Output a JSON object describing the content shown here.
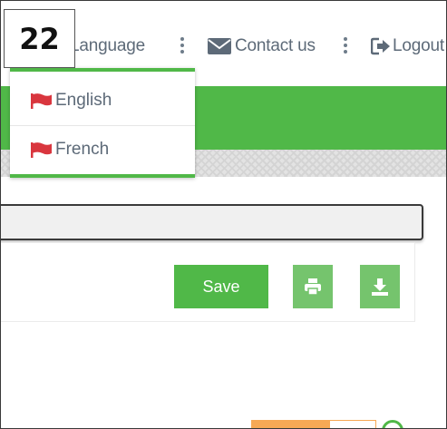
{
  "step": {
    "number": "22"
  },
  "topnav": {
    "language_label": "Language",
    "contact_label": "Contact us",
    "logout_label": "Logout"
  },
  "language_menu": {
    "items": [
      {
        "label": "English",
        "icon": "flag-icon"
      },
      {
        "label": "French",
        "icon": "flag-icon"
      }
    ]
  },
  "toolbar": {
    "save_label": "Save",
    "print_icon": "printer-icon",
    "download_icon": "download-icon"
  },
  "colors": {
    "brand_green": "#50b848",
    "light_green": "#75c46d",
    "flag_red": "#d9363e",
    "nav_text": "#5d6a78",
    "accent_orange": "#f7a955"
  }
}
